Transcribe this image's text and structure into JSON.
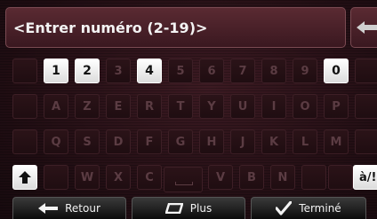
{
  "input": {
    "placeholder_text": "<Entrer numéro (2-19)>"
  },
  "keyboard": {
    "row1": [
      "1",
      "2",
      "3",
      "4",
      "5",
      "6",
      "7",
      "8",
      "9",
      "0"
    ],
    "row1_active": [
      true,
      true,
      false,
      true,
      false,
      false,
      false,
      false,
      false,
      true
    ],
    "row2": [
      "A",
      "Z",
      "E",
      "R",
      "T",
      "Y",
      "U",
      "I",
      "O",
      "P"
    ],
    "row3": [
      "Q",
      "S",
      "D",
      "F",
      "G",
      "H",
      "J",
      "K",
      "L",
      "M"
    ],
    "row4": [
      "W",
      "X",
      "C",
      "V",
      "B",
      "N"
    ],
    "accent_label": "à/!"
  },
  "bottom": {
    "back_label": "Retour",
    "more_label": "Plus",
    "done_label": "Terminé"
  },
  "icons": {
    "backspace": "backspace-arrow-icon",
    "shift": "shift-arrow-icon",
    "back": "left-arrow-icon",
    "more": "rounded-rectangle-icon",
    "done": "checkmark-icon"
  }
}
